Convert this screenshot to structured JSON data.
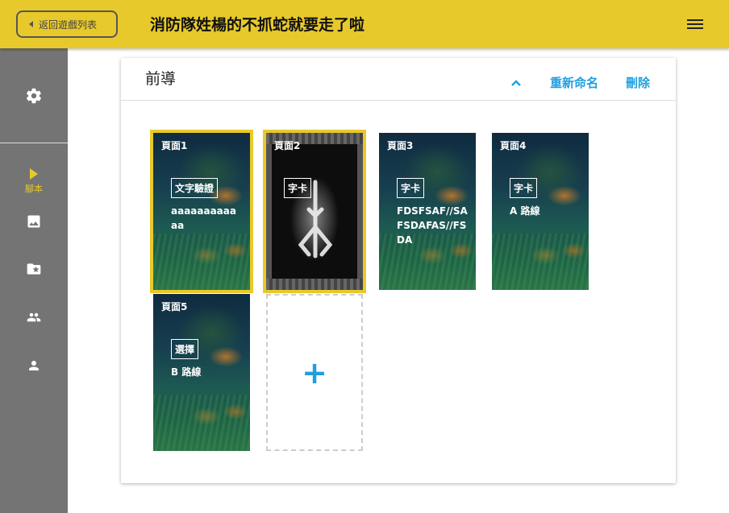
{
  "header": {
    "back_label": "返回遊戲列表",
    "title": "消防隊姓楊的不抓蛇就要走了啦",
    "menu_icon": "hamburger-menu-icon"
  },
  "sidebar": {
    "items": [
      {
        "icon": "settings-icon",
        "label": ""
      },
      {
        "icon": "play-icon",
        "label": "腳本",
        "active": true
      },
      {
        "icon": "image-icon",
        "label": ""
      },
      {
        "icon": "folder-star-icon",
        "label": ""
      },
      {
        "icon": "people-icon",
        "label": ""
      },
      {
        "icon": "person-icon",
        "label": ""
      }
    ],
    "active_color": "#E8C92B"
  },
  "panel": {
    "title": "前導",
    "collapse_icon": "chevron-up-icon",
    "rename_label": "重新命名",
    "delete_label": "刪除"
  },
  "pages": [
    {
      "name": "頁面1",
      "type": "文字驗證",
      "text": "aaaaaaaaaaaa",
      "selected": true
    },
    {
      "name": "頁面2",
      "type": "字卡",
      "text": "",
      "selected": true
    },
    {
      "name": "頁面3",
      "type": "字卡",
      "text": "FDSFSAF//SAFSDAFAS//FSDA",
      "selected": false
    },
    {
      "name": "頁面4",
      "type": "字卡",
      "text": "A 路線",
      "selected": false
    },
    {
      "name": "頁面5",
      "type": "選擇",
      "text": "B 路線",
      "selected": false
    }
  ],
  "add_icon": "plus-icon",
  "colors": {
    "accent": "#1E9FE0",
    "brand": "#E8C92B",
    "sidebar": "#747474"
  }
}
